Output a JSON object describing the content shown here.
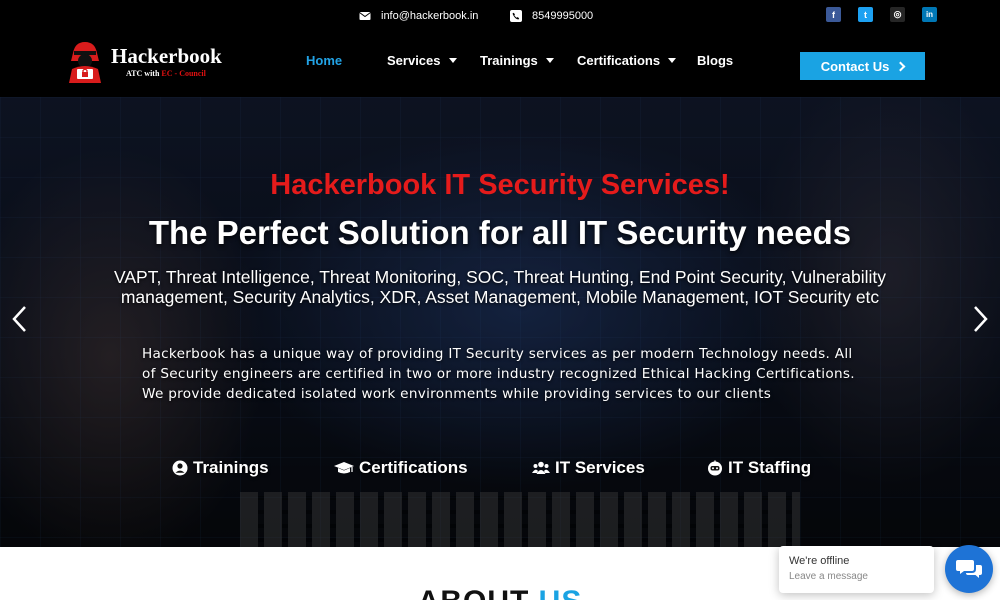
{
  "topbar": {
    "email": "info@hackerbook.in",
    "phone": "8549995000",
    "email_icon": "envelope-icon",
    "phone_icon": "phone-icon",
    "social": [
      {
        "name": "facebook-icon",
        "glyph": "f",
        "color": "#3b5998"
      },
      {
        "name": "twitter-icon",
        "glyph": "t",
        "color": "#1da1f2"
      },
      {
        "name": "instagram-icon",
        "glyph": "◎",
        "color": "#262626"
      },
      {
        "name": "linkedin-icon",
        "glyph": "in",
        "color": "#0077b5"
      }
    ]
  },
  "header": {
    "logo_title": "Hackerbook",
    "logo_sub_prefix": "ATC with ",
    "logo_sub_accent": "EC - Council",
    "nav": [
      {
        "label": "Home",
        "active": true,
        "dropdown": false
      },
      {
        "label": "Services",
        "active": false,
        "dropdown": true
      },
      {
        "label": "Trainings",
        "active": false,
        "dropdown": true
      },
      {
        "label": "Certifications",
        "active": false,
        "dropdown": true
      },
      {
        "label": "Blogs",
        "active": false,
        "dropdown": false
      }
    ],
    "contact_label": "Contact Us"
  },
  "hero": {
    "headline_red": "Hackerbook IT Security Services!",
    "headline_white": "The Perfect Solution for all IT Security needs",
    "services_list": "VAPT, Threat Intelligence, Threat Monitoring, SOC, Threat Hunting, End Point Security, Vulnerability management, Security Analytics, XDR, Asset Management, Mobile Management, IOT Security etc",
    "paragraph": "Hackerbook has a unique way of providing IT Security services as per modern Technology needs. All of Security engineers are certified in two or more industry recognized Ethical Hacking Certifications. We provide dedicated isolated work environments while providing services to our clients",
    "links": [
      {
        "label": "Trainings",
        "icon": "user-circle-icon"
      },
      {
        "label": "Certifications",
        "icon": "graduation-cap-icon"
      },
      {
        "label": "IT Services",
        "icon": "users-icon"
      },
      {
        "label": "IT Staffing",
        "icon": "robot-icon"
      }
    ]
  },
  "about": {
    "title_main": "ABOUT ",
    "title_accent": "US"
  },
  "chat": {
    "status": "We're offline",
    "prompt": "Leave a message"
  },
  "colors": {
    "accent_blue": "#1aa3e3",
    "headline_red": "#e51b1b",
    "chat_blue": "#1e73d6"
  }
}
